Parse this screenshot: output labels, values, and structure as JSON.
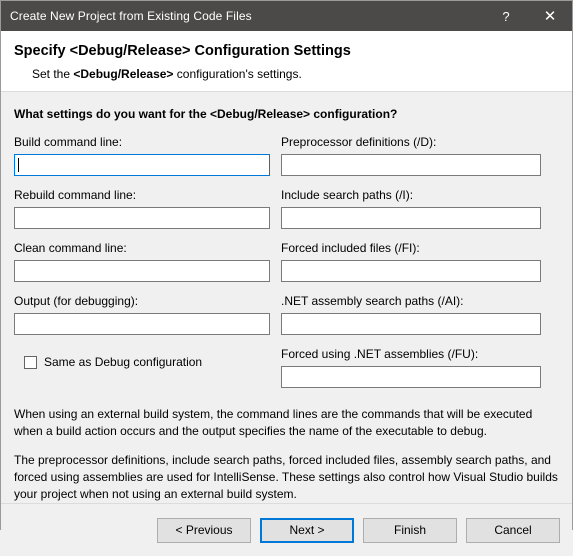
{
  "window": {
    "title": "Create New Project from Existing Code Files",
    "help_label": "?",
    "close_label": "✕",
    "titlebar_color": "#4c4a48",
    "accent_color": "#0078d7"
  },
  "header": {
    "title": "Specify <Debug/Release> Configuration Settings",
    "subtitle_prefix": "Set the ",
    "subtitle_bold": "<Debug/Release>",
    "subtitle_suffix": " configuration's settings."
  },
  "main": {
    "question": "What settings do you want for the <Debug/Release> configuration?",
    "left_fields": [
      {
        "label": "Build command line:",
        "value": "",
        "focused": true
      },
      {
        "label": "Rebuild command line:",
        "value": "",
        "focused": false
      },
      {
        "label": "Clean command line:",
        "value": "",
        "focused": false
      },
      {
        "label": "Output (for debugging):",
        "value": "",
        "focused": false
      }
    ],
    "right_fields": [
      {
        "label": "Preprocessor definitions (/D):",
        "value": "",
        "focused": false
      },
      {
        "label": "Include search paths (/I):",
        "value": "",
        "focused": false
      },
      {
        "label": "Forced included files (/FI):",
        "value": "",
        "focused": false
      },
      {
        "label": ".NET assembly search paths (/AI):",
        "value": "",
        "focused": false
      },
      {
        "label": "Forced using .NET assemblies (/FU):",
        "value": "",
        "focused": false
      }
    ],
    "checkbox": {
      "label": "Same as Debug configuration",
      "checked": false
    },
    "description": [
      "When using an external build system, the command lines are the commands that will be executed when a build action occurs and the output specifies the name of the executable to debug.",
      "The preprocessor definitions, include search paths, forced included files, assembly search paths, and forced using assemblies are used for IntelliSense.  These settings also control how Visual Studio builds your project when not using an external build system."
    ]
  },
  "footer": {
    "buttons": [
      {
        "label": "< Previous",
        "default": false
      },
      {
        "label": "Next >",
        "default": true
      },
      {
        "label": "Finish",
        "default": false
      },
      {
        "label": "Cancel",
        "default": false
      }
    ]
  }
}
